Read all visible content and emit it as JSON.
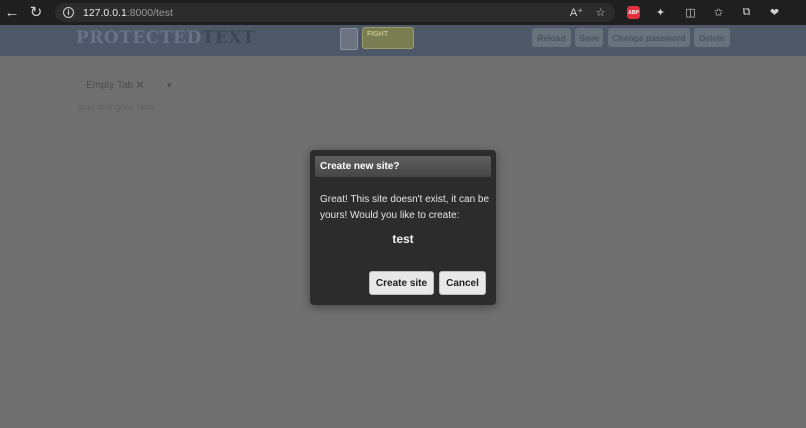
{
  "browser": {
    "url_host": "127.0.0.1",
    "url_path": ":8000/test",
    "abp_label": "ABP"
  },
  "header": {
    "logo_part1": "PROTECTED",
    "logo_part2": "TEXT",
    "badge_text": "FIGHT",
    "buttons": {
      "reload": "Reload",
      "save": "Save",
      "change_password": "Change password",
      "delete": "Delete"
    }
  },
  "editor": {
    "tab_label": "Empty Tab",
    "placeholder": "your text goes here..."
  },
  "dialog": {
    "title": "Create new site?",
    "message": "Great! This site doesn't exist, it can be yours! Would you like to create:",
    "site_name": "test",
    "create_label": "Create site",
    "cancel_label": "Cancel"
  }
}
